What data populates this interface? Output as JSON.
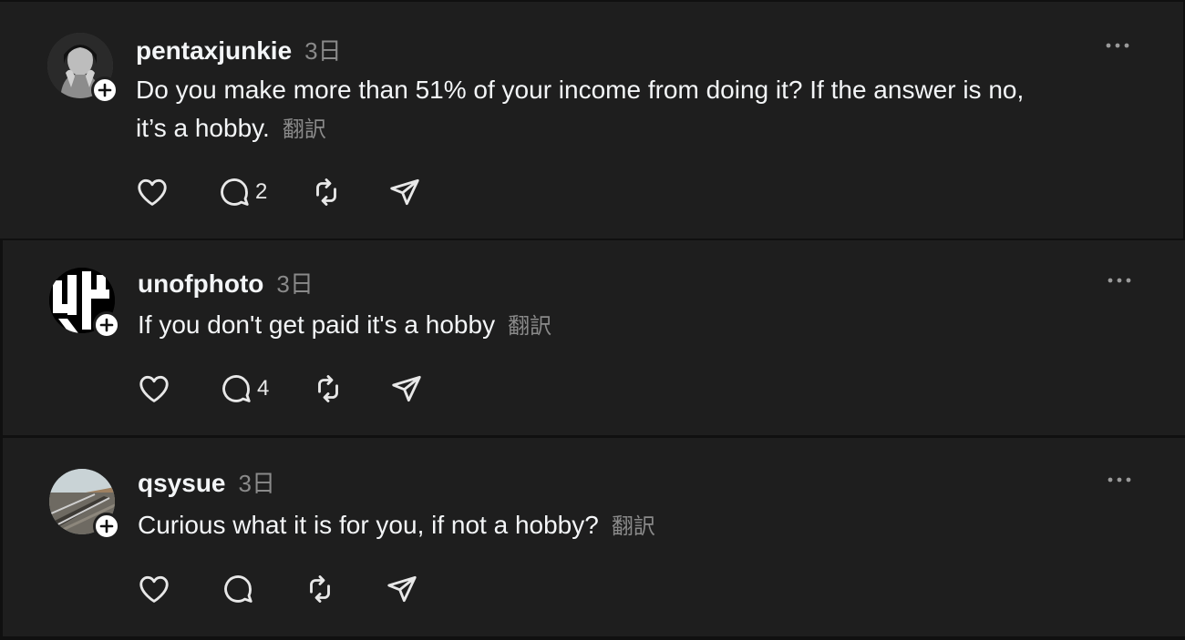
{
  "posts": [
    {
      "username": "pentaxjunkie",
      "time": "3日",
      "text_line1": "Do you make more than 51% of your income from doing it? If the answer is no,",
      "text_line2": "it’s a hobby.",
      "translate_label": "翻訳",
      "reply_count": "2",
      "avatar": "person-portrait-avatar"
    },
    {
      "username": "unofphoto",
      "time": "3日",
      "text": "If you don't get paid it's a hobby",
      "translate_label": "翻訳",
      "reply_count": "4",
      "avatar": "black-white-logo-avatar"
    },
    {
      "username": "qsysue",
      "time": "3日",
      "text": "Curious what it is for you, if not a hobby?",
      "translate_label": "翻訳",
      "reply_count": "",
      "avatar": "railroad-tracks-avatar"
    }
  ],
  "icons": {
    "like": "heart-icon",
    "reply": "comment-icon",
    "repost": "repost-icon",
    "share": "send-icon",
    "more": "more-icon",
    "follow": "plus-icon"
  },
  "colors": {
    "background": "#1e1e1e",
    "separator": "#101010",
    "text": "#f3f5f7",
    "secondary": "#8a8a8a"
  }
}
